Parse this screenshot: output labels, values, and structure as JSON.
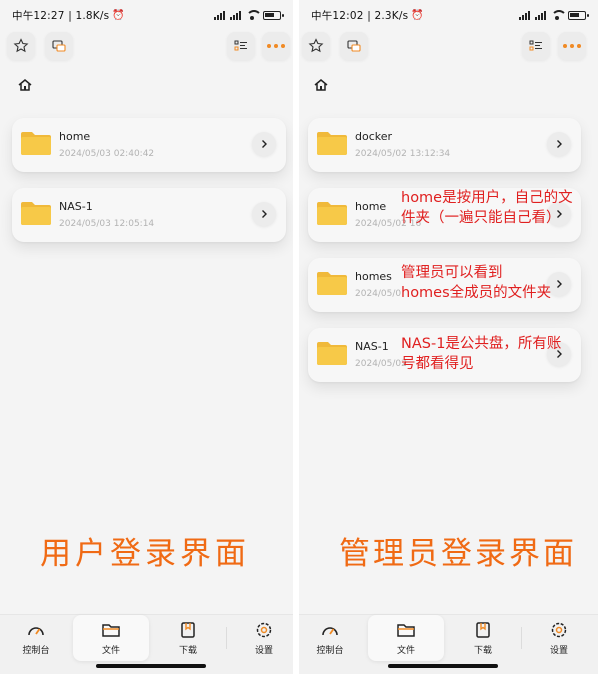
{
  "screens": [
    {
      "status": {
        "time": "中午12:27 | 1.8K/s"
      },
      "files": [
        {
          "name": "home",
          "date": "2024/05/03 02:40:42"
        },
        {
          "name": "NAS-1",
          "date": "2024/05/03 12:05:14"
        }
      ],
      "caption": "用户登录界面",
      "tabs": [
        "控制台",
        "文件",
        "下载",
        "设置"
      ]
    },
    {
      "status": {
        "time": "中午12:02 | 2.3K/s"
      },
      "files": [
        {
          "name": "docker",
          "date": "2024/05/02 13:12:34"
        },
        {
          "name": "home",
          "date": "2024/05/02 16"
        },
        {
          "name": "homes",
          "date": "2024/05/0"
        },
        {
          "name": "NAS-1",
          "date": "2024/05/02"
        }
      ],
      "annotations": [
        [
          "home是按用户，自己的文",
          "件夹（一遍只能自己看）"
        ],
        [
          "管理员可以看到",
          "homes全成员的文件夹"
        ],
        [
          "NAS-1是公共盘，所有账",
          "号都看得见"
        ]
      ],
      "caption": "管理员登录界面",
      "tabs": [
        "控制台",
        "文件",
        "下载",
        "设置"
      ]
    }
  ],
  "icons": {
    "toolbar": [
      "star-icon",
      "sync-folder-icon",
      "list-view-icon",
      "more-icon"
    ],
    "breadcrumb": "home-icon",
    "folder": "folder-icon",
    "tabs": [
      "dashboard-gauge-icon",
      "folder-tab-icon",
      "download-box-icon",
      "gear-icon"
    ]
  },
  "colors": {
    "annotation": "#e02020",
    "caption": "#f06a14",
    "folder": "#f7c948",
    "more_dots": "#f08a24"
  }
}
